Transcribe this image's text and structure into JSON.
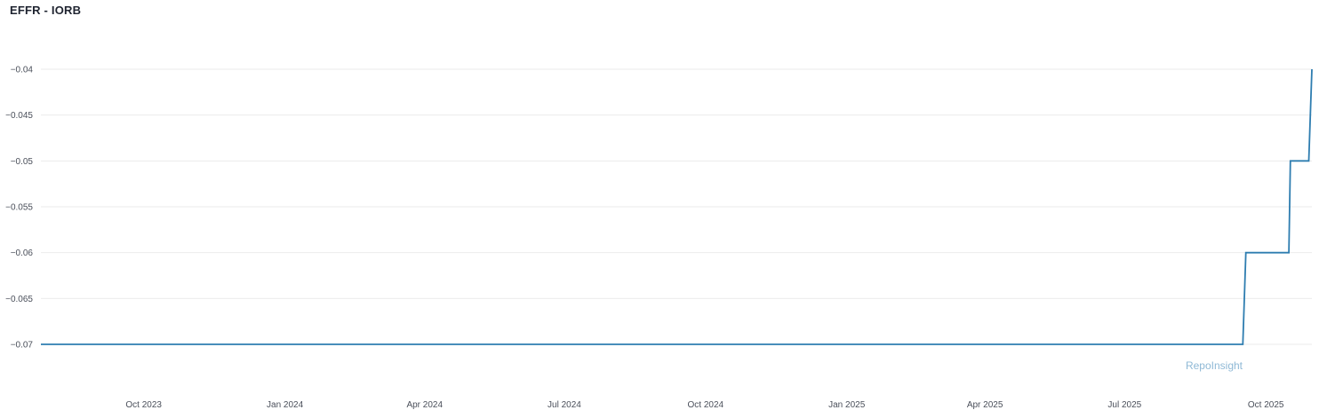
{
  "chart_data": {
    "type": "line",
    "title": "EFFR - IORB",
    "xlabel": "",
    "ylabel": "",
    "x_range": [
      "2023-07-26",
      "2025-10-31"
    ],
    "ylim": [
      -0.07,
      -0.04
    ],
    "yticks": [
      -0.04,
      -0.045,
      -0.05,
      -0.055,
      -0.06,
      -0.065,
      -0.07
    ],
    "ytick_labels": [
      "−0.04",
      "−0.045",
      "−0.05",
      "−0.055",
      "−0.06",
      "−0.065",
      "−0.07"
    ],
    "xticks": [
      {
        "date": "2023-10-01",
        "label": "Oct 2023"
      },
      {
        "date": "2024-01-01",
        "label": "Jan 2024"
      },
      {
        "date": "2024-04-01",
        "label": "Apr 2024"
      },
      {
        "date": "2024-07-01",
        "label": "Jul 2024"
      },
      {
        "date": "2024-10-01",
        "label": "Oct 2024"
      },
      {
        "date": "2025-01-01",
        "label": "Jan 2025"
      },
      {
        "date": "2025-04-01",
        "label": "Apr 2025"
      },
      {
        "date": "2025-07-01",
        "label": "Jul 2025"
      },
      {
        "date": "2025-10-01",
        "label": "Oct 2025"
      }
    ],
    "grid": true,
    "series": [
      {
        "color": "#2e7db0",
        "step": true,
        "points": [
          [
            "2023-07-26",
            -0.07
          ],
          [
            "2025-09-16",
            -0.07
          ],
          [
            "2025-09-18",
            -0.06
          ],
          [
            "2025-10-16",
            -0.06
          ],
          [
            "2025-10-17",
            -0.05
          ],
          [
            "2025-10-29",
            -0.05
          ],
          [
            "2025-10-31",
            -0.04
          ]
        ]
      }
    ]
  },
  "watermark": "RepoInsight"
}
